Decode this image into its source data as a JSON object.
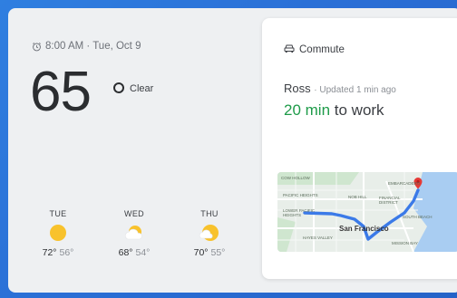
{
  "weather": {
    "datetime": "8:00 AM · Tue, Oct 9",
    "temperature": "65",
    "condition": "Clear",
    "forecast": [
      {
        "day": "TUE",
        "icon": "sun-icon",
        "high": "72°",
        "low": "56°"
      },
      {
        "day": "WED",
        "icon": "partly-cloudy-icon",
        "high": "68°",
        "low": "54°"
      },
      {
        "day": "THU",
        "icon": "partly-sunny-icon",
        "high": "70°",
        "low": "55°"
      }
    ]
  },
  "commute": {
    "title": "Commute",
    "destination": "Ross",
    "updated": "· Updated 1 min ago",
    "eta_minutes": "20 min",
    "eta_suffix": "to work",
    "map_labels": {
      "city": "San Francisco",
      "labels": [
        "COW HOLLOW",
        "PACIFIC HEIGHTS",
        "NOB HILL",
        "FINANCIAL DISTRICT",
        "LOWER PACIFIC HEIGHTS",
        "EMBARCADERO",
        "HAYES VALLEY",
        "MISSION BAY",
        "SOUTH BEACH"
      ]
    }
  },
  "colors": {
    "background": "#2a6fd6",
    "eta_green": "#1e9b49",
    "route_blue": "#3b7ae8",
    "pin_red": "#e53935",
    "sun_yellow": "#f8c22c"
  }
}
